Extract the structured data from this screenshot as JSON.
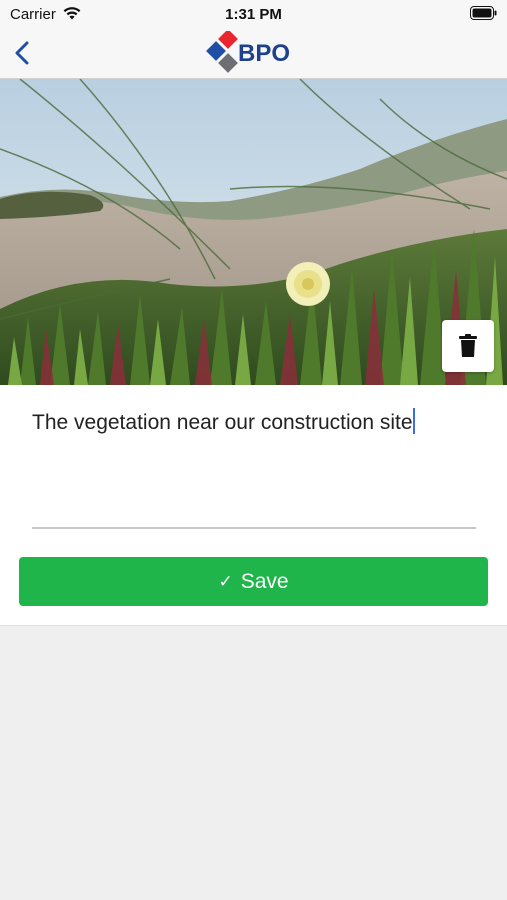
{
  "status_bar": {
    "carrier": "Carrier",
    "time": "1:31 PM"
  },
  "nav": {
    "back_icon": "chevron-left-icon",
    "logo_text": "BPO",
    "logo_colors": {
      "red": "#e8262f",
      "blue": "#1f4ea5",
      "gray": "#6d6e71",
      "text": "#1f3f8f"
    }
  },
  "photo": {
    "delete_icon": "trash-icon"
  },
  "form": {
    "description_value": "The vegetation near our construction site",
    "save_icon": "checkmark-icon",
    "save_label": "Save"
  },
  "colors": {
    "accent_green": "#1fb54a",
    "caret_blue": "#3a6ee8"
  }
}
